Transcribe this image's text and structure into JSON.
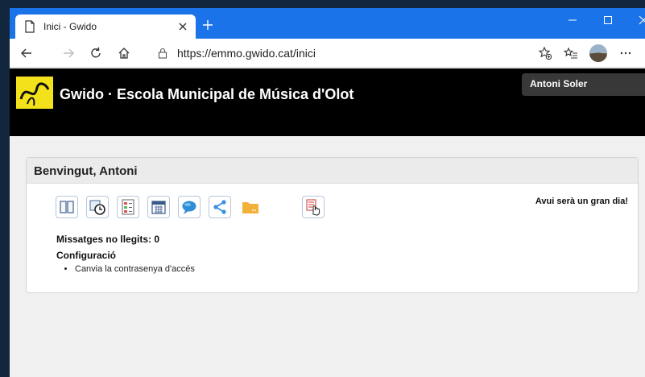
{
  "browser": {
    "tab_title": "Inici - Gwido",
    "url": "https://emmo.gwido.cat/inici",
    "accent": "#1a73e8"
  },
  "header": {
    "site_title": "Gwido · Escola Municipal de Música d'Olot",
    "user_name": "Antoni Soler",
    "background": "#000000",
    "logo_color": "#f3e21b"
  },
  "welcome": {
    "title": "Benvingut, Antoni",
    "slogan": "Avui serà un gran dia!",
    "icons": [
      "book-icon",
      "history-clock-icon",
      "grades-report-icon",
      "calendar-icon",
      "chat-bubble-icon",
      "share-icon",
      "folder-icon",
      "pointer-hand-icon"
    ],
    "unread_label": "Missatges no llegits: 0",
    "config_title": "Configuració",
    "config_items": [
      {
        "label": "Canvia la contrasenya d'accés"
      }
    ]
  }
}
